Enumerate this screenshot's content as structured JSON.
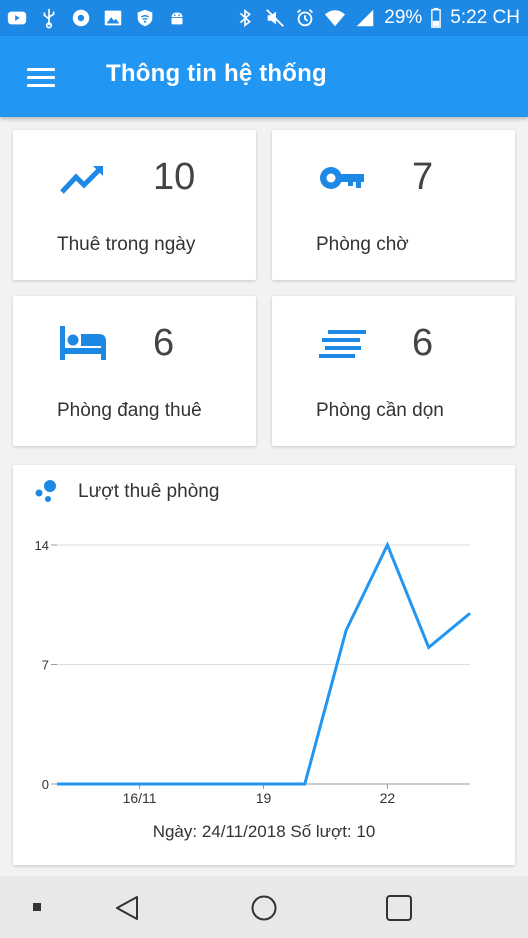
{
  "status_bar": {
    "left_icons": [
      "youtube-icon",
      "usb-icon",
      "chrome-icon",
      "image-icon",
      "wifi-shield-icon",
      "android-icon"
    ],
    "right_icons": [
      "bluetooth-icon",
      "mute-icon",
      "alarm-icon",
      "wifi-icon",
      "signal-icon",
      "battery-icon"
    ],
    "battery": "29%",
    "time": "5:22 CH"
  },
  "app_bar": {
    "menu_icon": "menu-icon",
    "title": "Thông tin hệ thống"
  },
  "stats": [
    {
      "icon": "trending-up-icon",
      "value": "10",
      "label": "Thuê trong ngày"
    },
    {
      "icon": "key-icon",
      "value": "7",
      "label": "Phòng chờ"
    },
    {
      "icon": "bed-icon",
      "value": "6",
      "label": "Phòng đang thuê"
    },
    {
      "icon": "lines-icon",
      "value": "6",
      "label": "Phòng cần dọn"
    }
  ],
  "chart_card": {
    "icon": "bubble-chart-icon",
    "title": "Lượt thuê phòng",
    "caption": "Ngày: 24/11/2018  Số lượt: 10"
  },
  "chart_data": {
    "type": "line",
    "title": "Lượt thuê phòng",
    "xlabel": "",
    "ylabel": "",
    "x": [
      14,
      15,
      16,
      17,
      18,
      19,
      20,
      21,
      22,
      23,
      24
    ],
    "series": [
      {
        "values": [
          0,
          0,
          0,
          0,
          0,
          0,
          0,
          9,
          14,
          8,
          10
        ]
      }
    ],
    "x_ticks": [
      16,
      19,
      22
    ],
    "x_tick_labels": [
      "16/11",
      "19",
      "22"
    ],
    "y_ticks": [
      0,
      7,
      14
    ],
    "xlim": [
      14,
      24
    ],
    "ylim": [
      0,
      14
    ],
    "grid": true,
    "color": "#2196f3"
  },
  "nav_bar": {
    "buttons": [
      "square-dot-icon",
      "back-icon",
      "home-icon",
      "recents-icon"
    ]
  },
  "colors": {
    "primary": "#2196f3",
    "status_bar": "#1e88e5",
    "accent_icon": "#1e88e5"
  }
}
